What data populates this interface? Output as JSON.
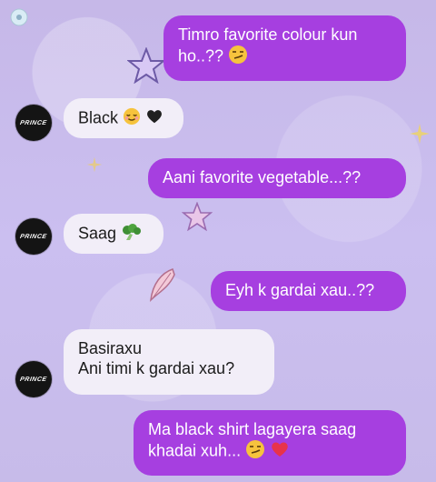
{
  "avatar_text": "PRINCE",
  "messages": [
    {
      "side": "sent",
      "line1": "Timro favorite colour kun",
      "line2": "ho..??",
      "emoji": "smirk"
    },
    {
      "side": "recv",
      "text": "Black",
      "emoji": "relieved-black-heart"
    },
    {
      "side": "sent",
      "text": "Aani favorite vegetable...??"
    },
    {
      "side": "recv",
      "text": "Saag",
      "emoji": "broccoli"
    },
    {
      "side": "sent",
      "text": "Eyh k gardai xau..??"
    },
    {
      "side": "recv",
      "line1": "Basiraxu",
      "line2": "Ani timi k gardai xau?"
    },
    {
      "side": "sent",
      "line1": "Ma black shirt lagayera saag",
      "line2": "khadai xuh...",
      "emoji": "smirk-red-heart"
    }
  ],
  "colors": {
    "sent_bubble": "#a63fe0",
    "recv_bubble": "#f2eef8",
    "background": "#c9bde9"
  }
}
